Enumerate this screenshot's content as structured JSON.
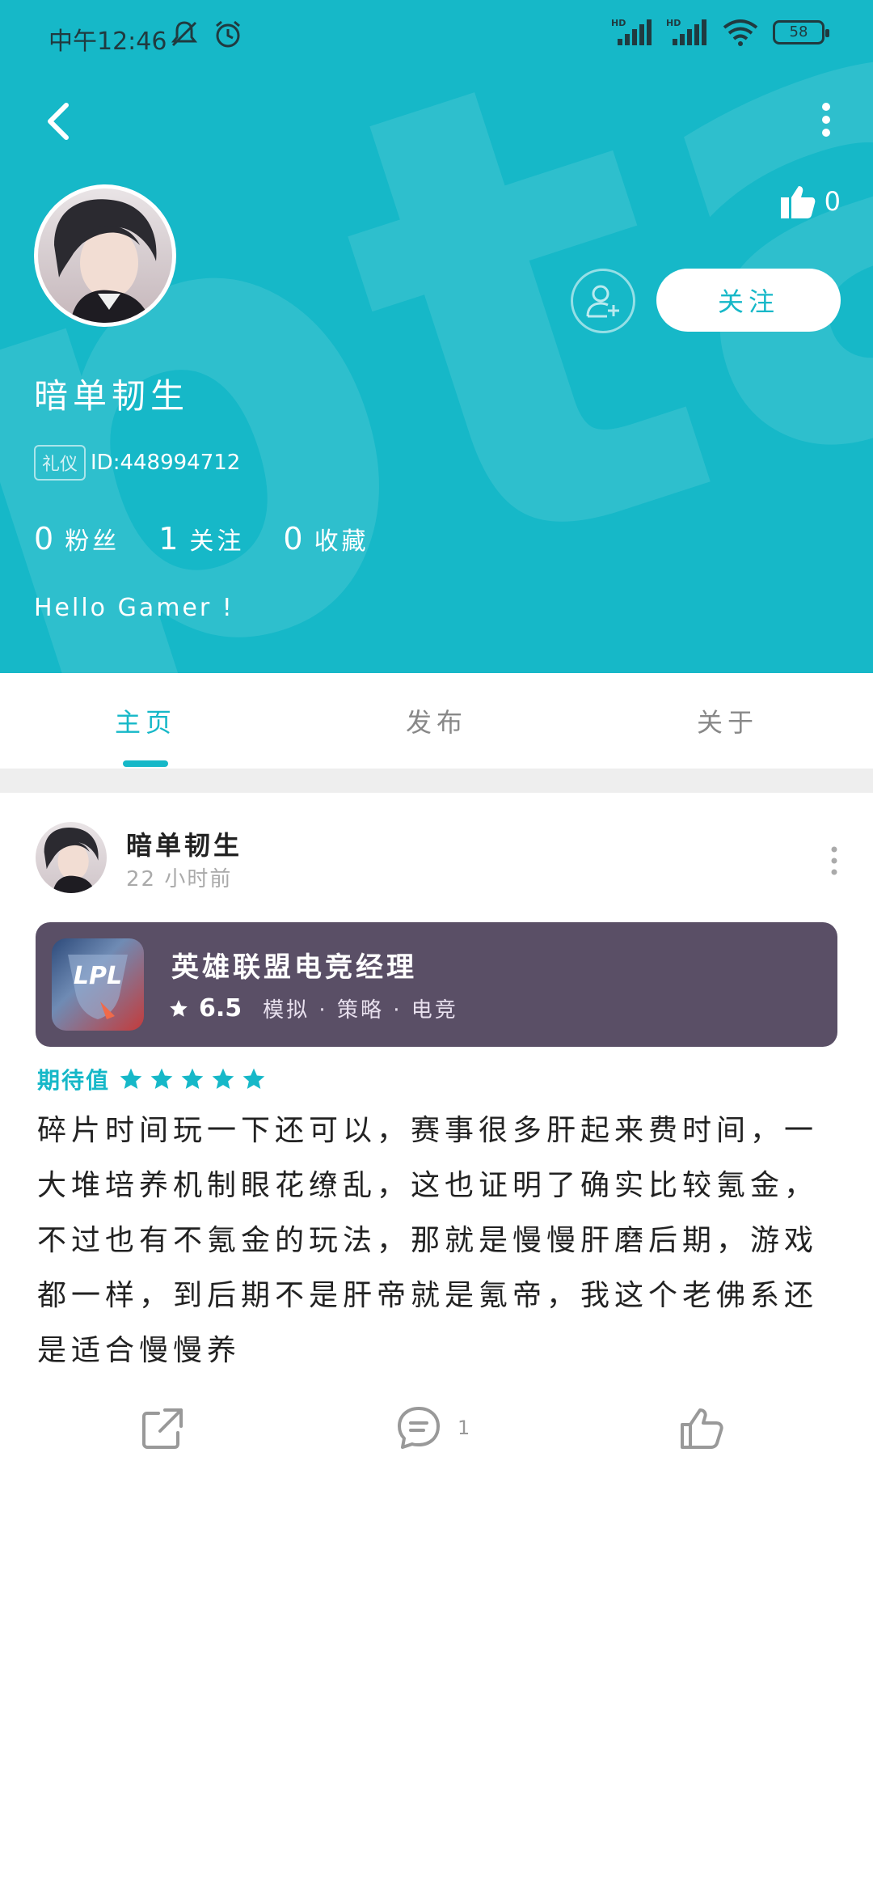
{
  "status_bar": {
    "time": "中午12:46",
    "battery": "58",
    "network1": "HD",
    "network2": "HD"
  },
  "profile": {
    "like_count": "0",
    "name": "暗单韧生",
    "role_tag": "礼仪",
    "user_id": "ID:448994712",
    "follow_label": "关注",
    "stats": [
      {
        "num": "0",
        "label": "粉丝"
      },
      {
        "num": "1",
        "label": "关注"
      },
      {
        "num": "0",
        "label": "收藏"
      }
    ],
    "bio": "Hello Gamer !"
  },
  "tabs": [
    {
      "label": "主页",
      "active": true
    },
    {
      "label": "发布",
      "active": false
    },
    {
      "label": "关于",
      "active": false
    }
  ],
  "post": {
    "author": "暗单韧生",
    "time": "22 小时前",
    "game": {
      "title": "英雄联盟电竞经理",
      "rating": "6.5",
      "genres": "模拟 · 策略 · 电竞",
      "icon_text": "LPL"
    },
    "expect_label": "期待值",
    "stars": 5,
    "text": "碎片时间玩一下还可以，赛事很多肝起来费时间，一大堆培养机制眼花缭乱，这也证明了确实比较氪金，不过也有不氪金的玩法，那就是慢慢肝磨后期，游戏都一样，到后期不是肝帝就是氪帝，我这个老佛系还是适合慢慢养",
    "comment_count": "1"
  },
  "colors": {
    "accent": "#16b8c8",
    "card": "#5a4f66"
  }
}
